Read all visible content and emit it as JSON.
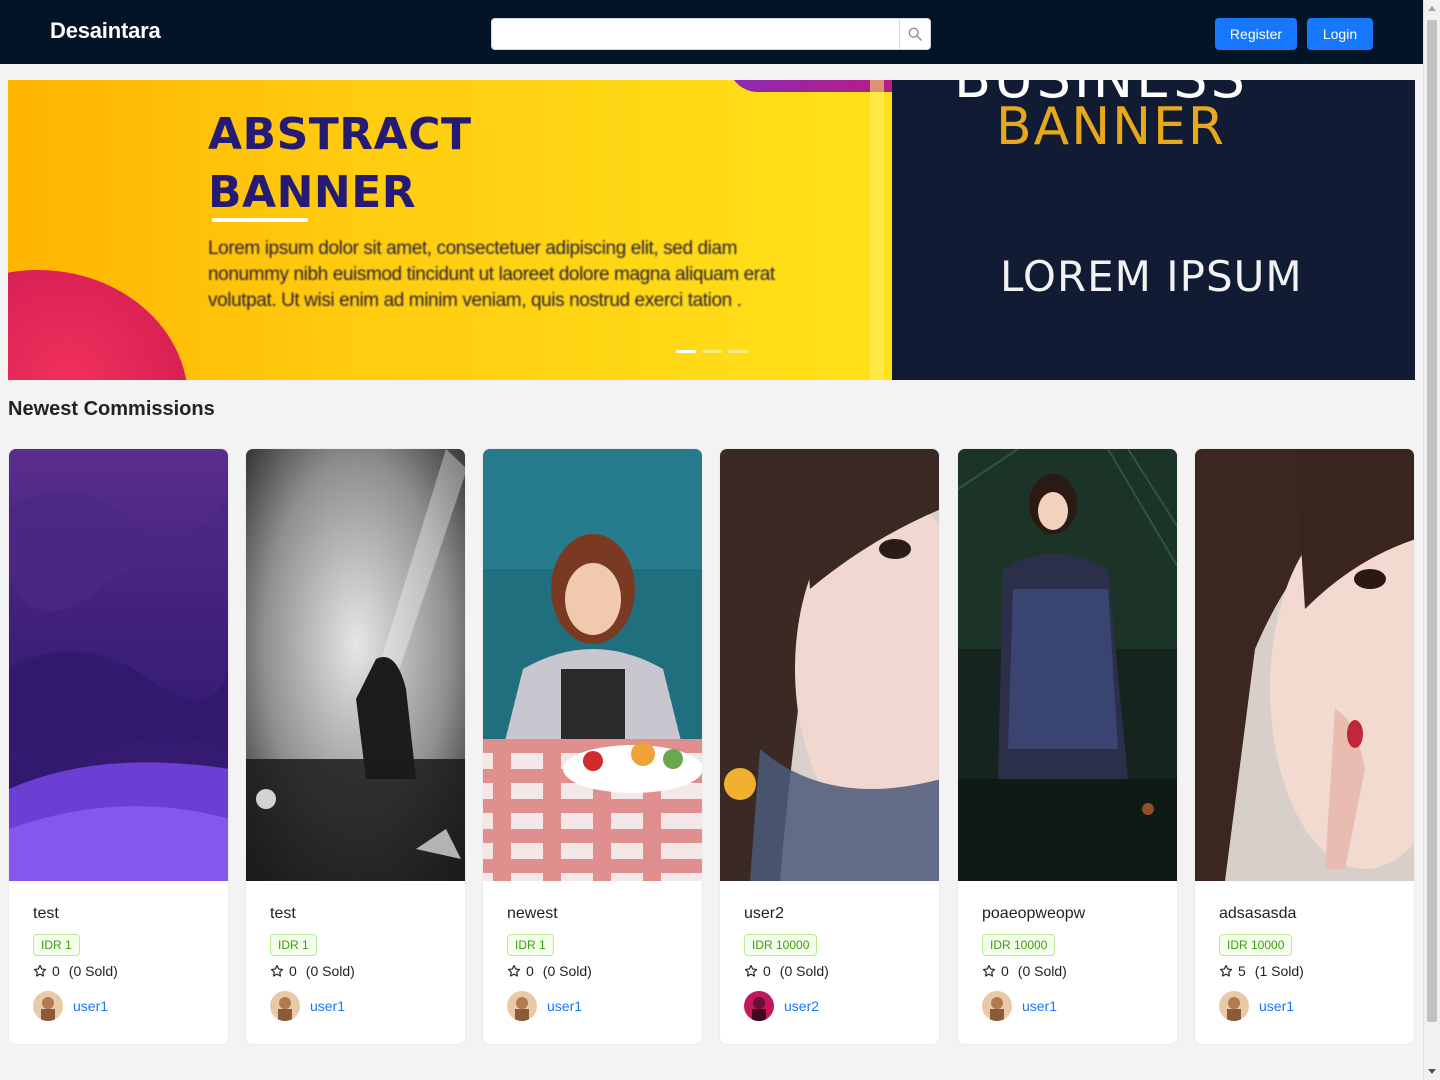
{
  "navbar": {
    "brand": "Desaintara",
    "search": {
      "value": "",
      "placeholder": ""
    },
    "search_button_icon": "search-icon",
    "register_label": "Register",
    "login_label": "Login",
    "colors": {
      "background": "#031427",
      "primary": "#1677ff"
    }
  },
  "carousel": {
    "active_index": 0,
    "slides": [
      {
        "title_line1": "ABSTRACT",
        "title_line2": "BANNER",
        "body": "Lorem ipsum dolor sit amet, consectetuer adipiscing elit, sed diam nonummy nibh euismod tincidunt ut laoreet dolore magna aliquam erat volutpat. Ut wisi enim ad minim veniam, quis nostrud exerci tation ."
      },
      {
        "title_line1": "BUSINESS",
        "title_line2": "BANNER",
        "subtitle": "LOREM IPSUM"
      }
    ],
    "dot_count": 3
  },
  "section": {
    "title": "Newest Commissions"
  },
  "cards": [
    {
      "title": "test",
      "price": "IDR 1",
      "rating": "0",
      "sold": "(0 Sold)",
      "author": "user1",
      "star_icon": "star-outline-icon"
    },
    {
      "title": "test",
      "price": "IDR 1",
      "rating": "0",
      "sold": "(0 Sold)",
      "author": "user1",
      "star_icon": "star-outline-icon"
    },
    {
      "title": "newest",
      "price": "IDR 1",
      "rating": "0",
      "sold": "(0 Sold)",
      "author": "user1",
      "star_icon": "star-outline-icon"
    },
    {
      "title": "user2",
      "price": "IDR 10000",
      "rating": "0",
      "sold": "(0 Sold)",
      "author": "user2",
      "star_icon": "star-outline-icon"
    },
    {
      "title": "poaeopweopw",
      "price": "IDR 10000",
      "rating": "0",
      "sold": "(0 Sold)",
      "author": "user1",
      "star_icon": "star-outline-icon"
    },
    {
      "title": "adsasasda",
      "price": "IDR 10000",
      "rating": "5",
      "sold": "(1 Sold)",
      "author": "user1",
      "star_icon": "star-outline-icon"
    }
  ]
}
